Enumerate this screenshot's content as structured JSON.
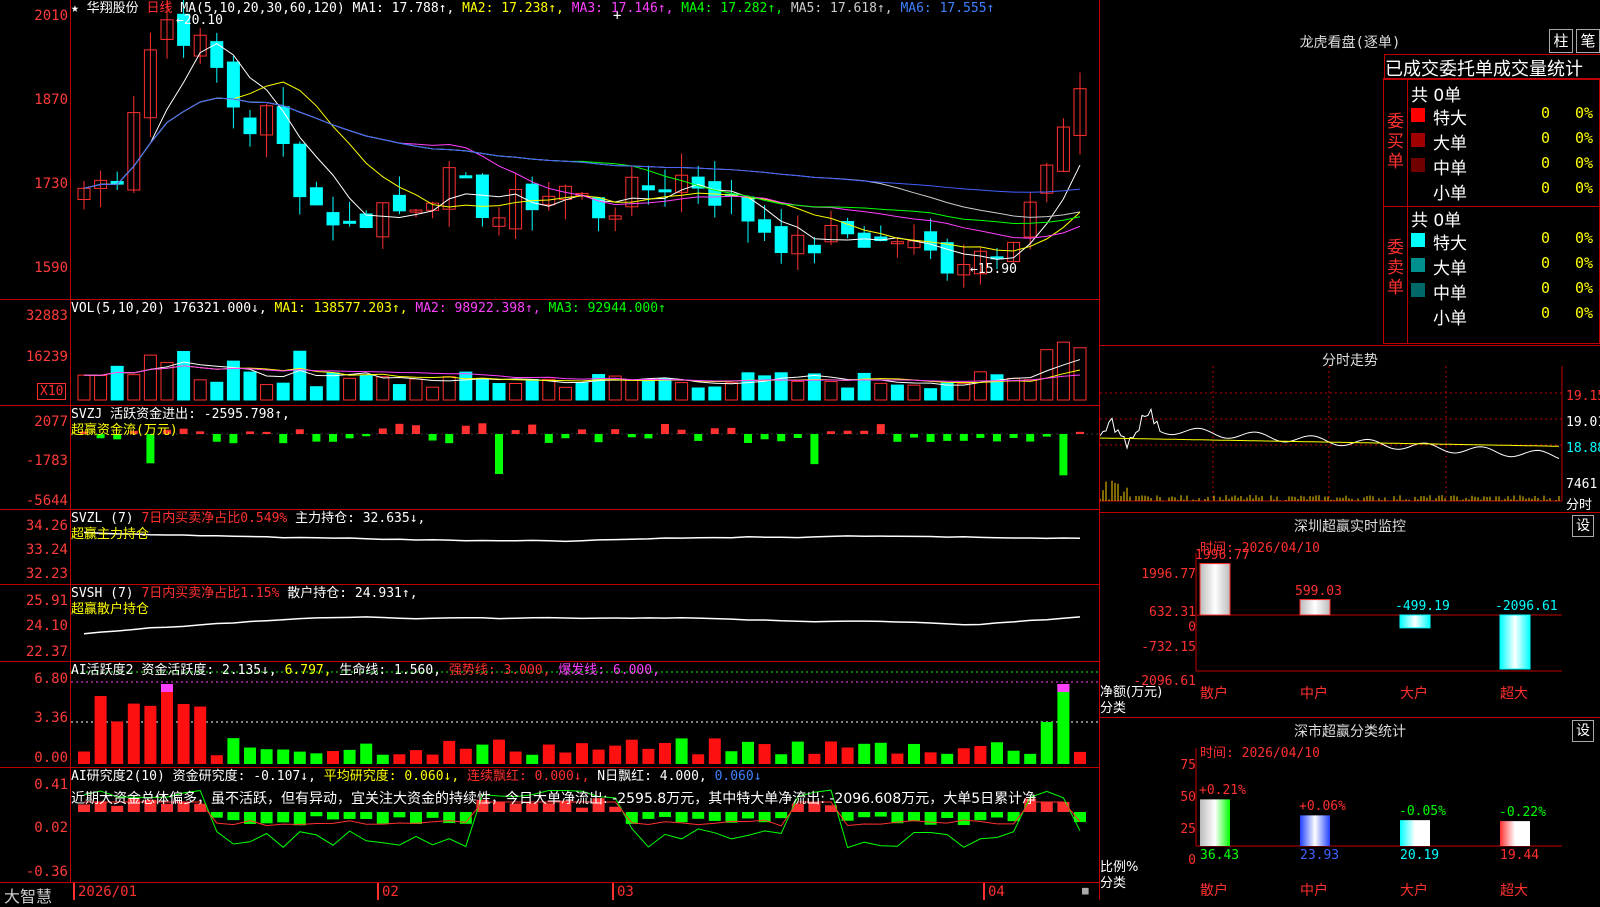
{
  "stock_name": "华翔股份",
  "period_label": "日线",
  "ma_header": {
    "params": "MA(5,10,20,30,60,120)",
    "items": [
      {
        "label": "MA1: 17.788↑,",
        "color": "#ffffff"
      },
      {
        "label": "MA2: 17.238↑,",
        "color": "#ffff00"
      },
      {
        "label": "MA3: 17.146↑,",
        "color": "#ff40ff"
      },
      {
        "label": "MA4: 17.282↑,",
        "color": "#00ff00"
      },
      {
        "label": "MA5: 17.618↑,",
        "color": "#cccccc"
      },
      {
        "label": "MA6: 17.555↑",
        "color": "#4060ff"
      }
    ]
  },
  "price_axis": [
    "2010",
    "1870",
    "1730",
    "1590"
  ],
  "price_high_label": "20.10",
  "price_low_label": "15.90",
  "vol_header": {
    "params": "VOL(5,10,20)",
    "value": "176321.000↓,",
    "ma1": "MA1: 138577.203↑,",
    "ma2": "MA2: 98922.398↑,",
    "ma3": "MA3: 92944.000↑"
  },
  "vol_axis": [
    "32883",
    "16239"
  ],
  "vol_unit": "X10",
  "svzj": {
    "params": "SVZJ",
    "text": "活跃资金进出: -2595.798↑,",
    "subtitle": "超赢资金流(万元)",
    "axis": [
      "2077",
      "-1783",
      "-5644"
    ]
  },
  "svzl": {
    "params": "SVZL (7)",
    "text1": "7日内买卖净占比0.549%",
    "text2": "主力持仓: 32.635↓,",
    "subtitle": "超赢主力持仓",
    "axis": [
      "34.26",
      "33.24",
      "32.23"
    ]
  },
  "svsh": {
    "params": "SVSH (7)",
    "text1": "7日内买卖净占比1.15%",
    "text2": "散户持仓: 24.931↑,",
    "subtitle": "超赢散户持仓",
    "axis": [
      "25.91",
      "24.10",
      "22.37"
    ]
  },
  "ai_active": {
    "params": "AI活跃度2",
    "t1": "资金活跃度: 2.135↓,",
    "t2": "6.797,",
    "t3": "生命线: 1.560,",
    "t4": "强势线: 3.000,",
    "t5": "爆发线: 6.000,",
    "axis": [
      "6.80",
      "3.36",
      "0.00"
    ]
  },
  "ai_research": {
    "params": "AI研究度2(10)",
    "t1": "资金研究度: -0.107↓,",
    "t2": "平均研究度: 0.060↓,",
    "t3": "连续飘红: 0.000↓,",
    "t4": "N日飘红: 4.000,",
    "t5": "0.060↓",
    "axis": [
      "0.41",
      "0.02",
      "-0.36"
    ],
    "comment": "近期大资金总体偏多，虽不活跃，但有异动，宜关注大资金的持续性，今日大单净流出: -2595.8万元，其中特大单净流出: -2096.608万元，大单5日累计净"
  },
  "date_axis": [
    "2026/01",
    "02",
    "03",
    "04"
  ],
  "brand": "大智慧",
  "right": {
    "lhb_title": "龙虎看盘(逐单)",
    "btn_zhu": "柱",
    "btn_bi": "笔",
    "lhb_header": "已成交委托单成交量统计",
    "buy_label": "委买单",
    "sell_label": "委卖单",
    "buy_total": "共 0单",
    "sell_total": "共 0单",
    "buy_rows": [
      {
        "name": "特大",
        "count": "0",
        "pct": "0%",
        "color": "#ff0000"
      },
      {
        "name": "大单",
        "count": "0",
        "pct": "0%",
        "color": "#a00000"
      },
      {
        "name": "中单",
        "count": "0",
        "pct": "0%",
        "color": "#700000"
      },
      {
        "name": "小单",
        "count": "0",
        "pct": "0%",
        "color": ""
      }
    ],
    "sell_rows": [
      {
        "name": "特大",
        "count": "0",
        "pct": "0%",
        "color": "#00ffff"
      },
      {
        "name": "大单",
        "count": "0",
        "pct": "0%",
        "color": "#009090"
      },
      {
        "name": "中单",
        "count": "0",
        "pct": "0%",
        "color": "#006868"
      },
      {
        "name": "小单",
        "count": "0",
        "pct": "0%",
        "color": ""
      }
    ],
    "fs_title": "分时走势",
    "fs_axis": [
      "19.15",
      "19.01",
      "18.88"
    ],
    "fs_vol": "7461",
    "fs_vol_unit": "分时",
    "monitor_title": "深圳超赢实时监控",
    "monitor_set": "设",
    "monitor_time": "时间: 2026/04/10",
    "monitor_axis": [
      "1996.77",
      "632.31",
      "0",
      "-732.15",
      "-2096.61"
    ],
    "monitor_ylabel1": "净额(万元)",
    "monitor_ylabel2": "分类",
    "monitor_bars": [
      {
        "cat": "散户",
        "value": "1996.77",
        "num": 1996.77
      },
      {
        "cat": "中户",
        "value": "599.03",
        "num": 599.03
      },
      {
        "cat": "大户",
        "value": "-499.19",
        "num": -499.19
      },
      {
        "cat": "超大",
        "value": "-2096.61",
        "num": -2096.61
      }
    ],
    "stat_title": "深市超赢分类统计",
    "stat_set": "设",
    "stat_time": "时间: 2026/04/10",
    "stat_axis": [
      "75",
      "50",
      "25",
      "0"
    ],
    "stat_ylabel1": "比例%",
    "stat_ylabel2": "分类",
    "stat_bars": [
      {
        "cat": "散户",
        "pct": "36.43",
        "chg": "+0.21%",
        "num": 36.43
      },
      {
        "cat": "中户",
        "pct": "23.93",
        "chg": "+0.06%",
        "num": 23.93
      },
      {
        "cat": "大户",
        "pct": "20.19",
        "chg": "-0.05%",
        "num": 20.19
      },
      {
        "cat": "超大",
        "pct": "19.44",
        "chg": "-0.22%",
        "num": 19.44
      }
    ]
  }
}
